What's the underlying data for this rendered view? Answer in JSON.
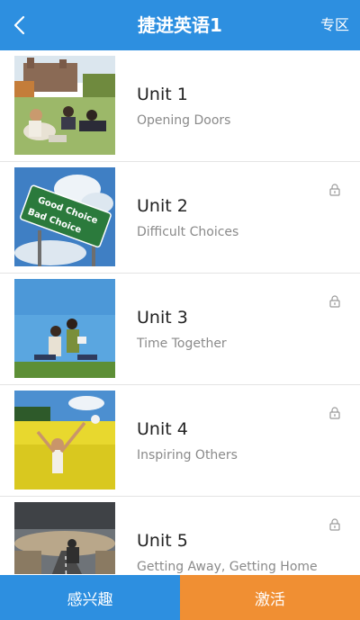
{
  "header": {
    "title": "捷进英语1",
    "right_label": "专区",
    "back_icon": "chevron-left-icon"
  },
  "units": [
    {
      "title": "Unit 1",
      "subtitle": "Opening Doors",
      "locked": false
    },
    {
      "title": "Unit 2",
      "subtitle": "Difficult Choices",
      "locked": true,
      "sign_text_1": "Good Choice",
      "sign_text_2": "Bad Choice"
    },
    {
      "title": "Unit 3",
      "subtitle": "Time Together",
      "locked": true
    },
    {
      "title": "Unit 4",
      "subtitle": "Inspiring Others",
      "locked": true
    },
    {
      "title": "Unit 5",
      "subtitle": "Getting Away, Getting Home",
      "locked": true
    }
  ],
  "footer": {
    "interest_label": "感兴趣",
    "activate_label": "激活"
  },
  "colors": {
    "primary": "#2d8fe0",
    "accent": "#f08f33"
  }
}
